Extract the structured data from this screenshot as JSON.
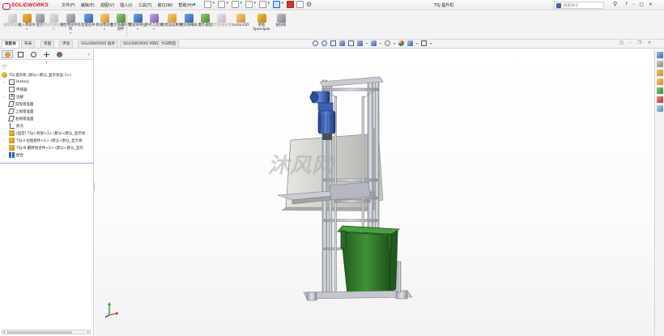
{
  "app": {
    "brand": "SOLIDWORKS",
    "document_title": "TSJ 提升机"
  },
  "menu": [
    "文件(F)",
    "编辑(E)",
    "视图(V)",
    "插入(I)",
    "工具(T)",
    "窗口(W)",
    "帮助(H)"
  ],
  "search": {
    "placeholder": "搜索命令"
  },
  "title_controls": [
    "?",
    "-",
    "▢",
    "×"
  ],
  "ribbon": {
    "tools": [
      {
        "label": "编辑零部件",
        "enabled": false
      },
      {
        "label": "插入零部件",
        "enabled": true
      },
      {
        "label": "配合",
        "enabled": true
      },
      {
        "label": "零部件预览窗口",
        "enabled": false
      },
      {
        "label": "线性零部件阵列",
        "enabled": true
      },
      {
        "label": "智能扣件",
        "enabled": true
      },
      {
        "label": "移动零部件",
        "enabled": true
      },
      {
        "label": "显示隐藏的零部件",
        "enabled": true
      },
      {
        "label": "装配体特征",
        "enabled": true
      },
      {
        "label": "参考几何体",
        "enabled": true
      },
      {
        "label": "新建运动算例",
        "enabled": true
      },
      {
        "label": "材料明细表",
        "enabled": true
      },
      {
        "label": "爆炸视图",
        "enabled": true
      },
      {
        "label": "爆炸直线草图",
        "enabled": false
      },
      {
        "label": "Instant3D",
        "enabled": true
      },
      {
        "label": "更新Speedpak",
        "enabled": true
      },
      {
        "label": "拍快照",
        "enabled": true
      }
    ]
  },
  "tabs": [
    "装配体",
    "布局",
    "草图",
    "评估",
    "SOLIDWORKS 插件",
    "SOLIDWORKS MBD",
    "今日制造"
  ],
  "active_tab": "装配体",
  "feature_tree": {
    "root": "TSJ 提升机 (默认<默认_显示状态-1>)",
    "items": [
      {
        "label": "History",
        "icon": "history-icon",
        "expandable": true
      },
      {
        "label": "传感器",
        "icon": "sensor-icon",
        "expandable": false
      },
      {
        "label": "注解",
        "icon": "annotation-icon",
        "expandable": true
      },
      {
        "label": "前视基准面",
        "icon": "plane-icon",
        "expandable": false
      },
      {
        "label": "上视基准面",
        "icon": "plane-icon",
        "expandable": false
      },
      {
        "label": "右视基准面",
        "icon": "plane-icon",
        "expandable": false
      },
      {
        "label": "原点",
        "icon": "origin-icon",
        "expandable": false
      },
      {
        "label": "(固定) TSJ-I 机架<1> (默认<默认_显示状",
        "icon": "part-icon",
        "expandable": true
      },
      {
        "label": "TSJ-II 拉框组件<1> (默认<默认_显示状",
        "icon": "part-icon",
        "expandable": true
      },
      {
        "label": "TSJ-III 翻转组合件<1> (默认<默认_显示",
        "icon": "part-icon",
        "expandable": true
      },
      {
        "label": "配合",
        "icon": "mate-icon",
        "expandable": true
      }
    ]
  },
  "viewport": {
    "watermark": "沐风网",
    "model_colors": {
      "frame": "#b9bec6",
      "motor": "#3b5fb0",
      "bin": "#2f7a2a",
      "panel": "#c9c9c4"
    },
    "triad_colors": {
      "x": "#d43a2a",
      "y": "#2aa02a",
      "z": "#2b4fc0"
    }
  }
}
